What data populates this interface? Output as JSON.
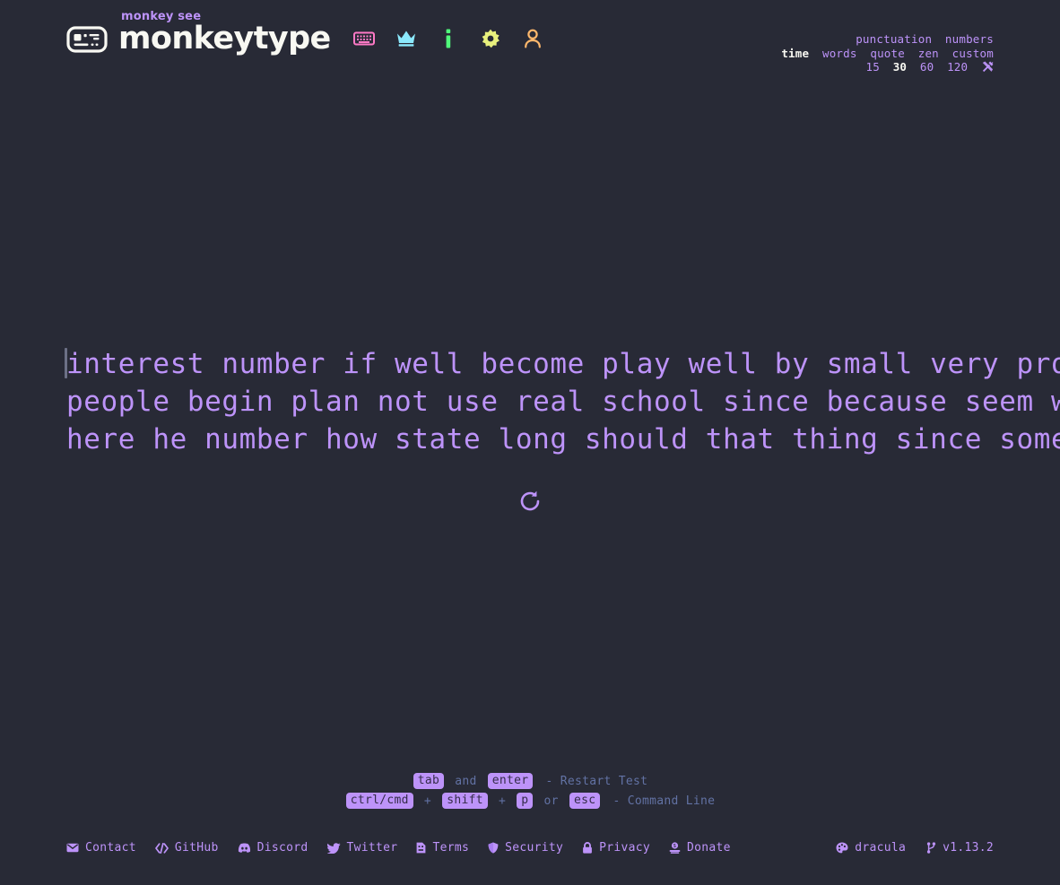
{
  "theme": {
    "name": "dracula",
    "background": "#282a36",
    "main": "#bd93f9",
    "sub": "#6272a4",
    "text": "#f8f8f2",
    "caret": "#6c7086"
  },
  "header": {
    "tagline": "monkey see",
    "brand": "monkeytype",
    "logo_icon": "monkeytype-logo-icon",
    "nav": [
      {
        "icon": "keyboard-icon",
        "label": "keyboard",
        "color": "#ff79c6"
      },
      {
        "icon": "crown-icon",
        "label": "leaderboards",
        "color": "#8be9fd"
      },
      {
        "icon": "info-icon",
        "label": "about",
        "color": "#50fa7b"
      },
      {
        "icon": "gear-icon",
        "label": "settings",
        "color": "#e8f07d"
      },
      {
        "icon": "user-icon",
        "label": "account",
        "color": "#ffb86c"
      }
    ]
  },
  "config": {
    "row1": [
      {
        "label": "punctuation",
        "active": false
      },
      {
        "label": "numbers",
        "active": false
      }
    ],
    "row2": [
      {
        "label": "time",
        "active": true
      },
      {
        "label": "words",
        "active": false
      },
      {
        "label": "quote",
        "active": false
      },
      {
        "label": "zen",
        "active": false
      },
      {
        "label": "custom",
        "active": false
      }
    ],
    "row3": [
      {
        "label": "15",
        "active": false
      },
      {
        "label": "30",
        "active": true
      },
      {
        "label": "60",
        "active": false
      },
      {
        "label": "120",
        "active": false
      }
    ],
    "tools_icon": "wrench-screwdriver-icon"
  },
  "test": {
    "lines": [
      "interest number if well become play well by small very problem",
      "people begin plan not use real school since because seem way order",
      "here he number how state long should that thing since some need"
    ],
    "caret_position": "start-of-first-word",
    "restart_icon": "restart-arrow-icon"
  },
  "hints": {
    "line1": {
      "key1": "tab",
      "conj": "and",
      "key2": "enter",
      "desc": "- Restart Test"
    },
    "line2": {
      "key1": "ctrl/cmd",
      "plus1": "+",
      "key2": "shift",
      "plus2": "+",
      "key3": "p",
      "conj": "or",
      "key4": "esc",
      "desc": "- Command Line"
    }
  },
  "footer": {
    "left": [
      {
        "label": "Contact",
        "icon": "envelope-icon"
      },
      {
        "label": "GitHub",
        "icon": "code-brackets-icon"
      },
      {
        "label": "Discord",
        "icon": "discord-icon"
      },
      {
        "label": "Twitter",
        "icon": "twitter-bird-icon"
      },
      {
        "label": "Terms",
        "icon": "document-icon"
      },
      {
        "label": "Security",
        "icon": "shield-icon"
      },
      {
        "label": "Privacy",
        "icon": "lock-icon"
      },
      {
        "label": "Donate",
        "icon": "donate-coin-icon"
      }
    ],
    "right": [
      {
        "label": "dracula",
        "icon": "palette-icon"
      },
      {
        "label": "v1.13.2",
        "icon": "git-branch-icon"
      }
    ]
  }
}
